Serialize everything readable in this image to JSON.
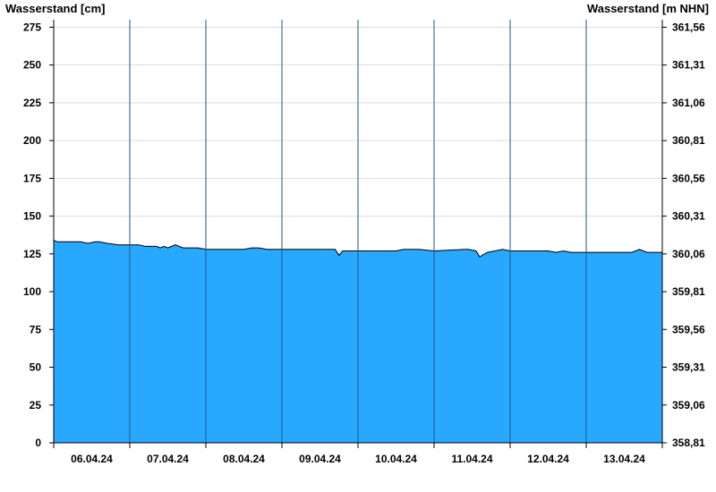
{
  "chart_data": {
    "type": "area",
    "ylabel_left": "Wasserstand [cm]",
    "ylabel_right": "Wasserstand [m NHN]",
    "ylim_left": [
      0,
      280
    ],
    "yticks_left": [
      "0",
      "25",
      "50",
      "75",
      "100",
      "125",
      "150",
      "175",
      "200",
      "225",
      "250",
      "275"
    ],
    "yticks_right": [
      "358,81",
      "359,06",
      "359,31",
      "359,56",
      "359,81",
      "360,06",
      "360,31",
      "360,56",
      "360,81",
      "361,06",
      "361,31",
      "361,56"
    ],
    "x_tick_labels": [
      "06.04.24",
      "07.04.24",
      "08.04.24",
      "09.04.24",
      "10.04.24",
      "11.04.24",
      "12.04.24",
      "13.04.24"
    ],
    "x_start_day": 5.0,
    "x_end_day": 13.0,
    "grid": "horizontal",
    "colors": {
      "fill": "#29a8ff",
      "line": "#000000",
      "grid": "#dddddd"
    },
    "series": [
      {
        "x": [
          5.0,
          5.05,
          5.35,
          5.45,
          5.55,
          5.6,
          5.7,
          5.85,
          5.95,
          6.0,
          6.12,
          6.2,
          6.3,
          6.35,
          6.4,
          6.45,
          6.5,
          6.55,
          6.6,
          6.7,
          6.9,
          7.0,
          7.2,
          7.5,
          7.6,
          7.7,
          7.8,
          8.0,
          8.5,
          8.7,
          8.75,
          8.8,
          9.0,
          9.5,
          9.6,
          9.8,
          10.0,
          10.4,
          10.45,
          10.55,
          10.6,
          10.7,
          10.8,
          10.9,
          11.0,
          11.5,
          11.6,
          11.7,
          11.8,
          12.0,
          12.45,
          12.5,
          12.6,
          12.65,
          12.7,
          12.8,
          13.0
        ],
        "values": [
          134,
          133,
          133,
          132,
          133,
          133,
          132,
          131,
          131,
          131,
          131,
          130,
          130,
          130,
          129,
          130,
          129,
          130,
          131,
          129,
          129,
          128,
          128,
          128,
          129,
          129,
          128,
          128,
          128,
          128,
          124,
          127,
          127,
          127,
          128,
          128,
          127,
          128,
          128,
          127,
          123,
          126,
          127,
          128,
          127,
          127,
          126,
          127,
          126,
          126,
          126,
          126,
          126,
          127,
          128,
          126,
          126
        ]
      }
    ]
  }
}
